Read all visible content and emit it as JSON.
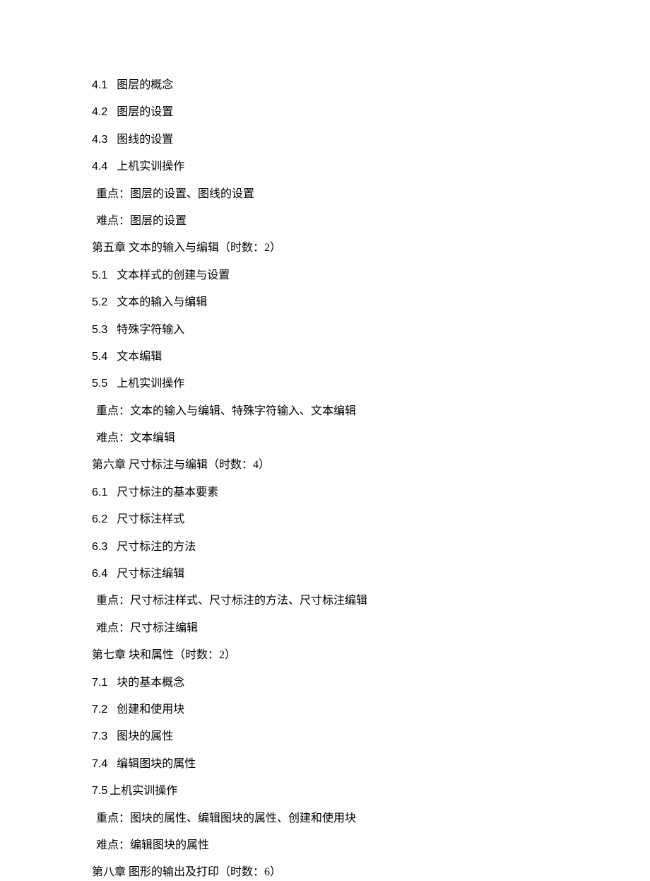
{
  "lines": [
    {
      "type": "sub",
      "num": "4.1",
      "text": "图层的概念"
    },
    {
      "type": "sub",
      "num": "4.2",
      "text": "图层的设置"
    },
    {
      "type": "sub",
      "num": "4.3",
      "text": "图线的设置"
    },
    {
      "type": "sub",
      "num": "4.4",
      "text": "上机实训操作"
    },
    {
      "type": "note",
      "text": "重点：图层的设置、图线的设置"
    },
    {
      "type": "note",
      "text": "难点：图层的设置"
    },
    {
      "type": "chapter",
      "text": "第五章  文本的输入与编辑（时数：2）"
    },
    {
      "type": "sub",
      "num": "5.1",
      "text": "文本样式的创建与设置"
    },
    {
      "type": "sub",
      "num": "5.2",
      "text": "文本的输入与编辑"
    },
    {
      "type": "sub",
      "num": "5.3",
      "text": "特殊字符输入"
    },
    {
      "type": "sub",
      "num": "5.4",
      "text": "文本编辑"
    },
    {
      "type": "sub",
      "num": "5.5",
      "text": "上机实训操作"
    },
    {
      "type": "note",
      "text": "重点：文本的输入与编辑、特殊字符输入、文本编辑"
    },
    {
      "type": "note",
      "text": "难点：文本编辑"
    },
    {
      "type": "chapter",
      "text": "第六章  尺寸标注与编辑（时数：4）"
    },
    {
      "type": "sub",
      "num": "6.1",
      "text": "尺寸标注的基本要素"
    },
    {
      "type": "sub",
      "num": "6.2",
      "text": "尺寸标注样式"
    },
    {
      "type": "sub",
      "num": "6.3",
      "text": "尺寸标注的方法"
    },
    {
      "type": "sub",
      "num": "6.4",
      "text": "尺寸标注编辑"
    },
    {
      "type": "note",
      "text": "重点：尺寸标注样式、尺寸标注的方法、尺寸标注编辑"
    },
    {
      "type": "note",
      "text": "难点：尺寸标注编辑"
    },
    {
      "type": "chapter",
      "text": "第七章  块和属性（时数：2）"
    },
    {
      "type": "sub",
      "num": "7.1",
      "text": "块的基本概念"
    },
    {
      "type": "sub",
      "num": "7.2",
      "text": "创建和使用块"
    },
    {
      "type": "sub",
      "num": "7.3",
      "text": "图块的属性"
    },
    {
      "type": "sub",
      "num": "7.4",
      "text": "编辑图块的属性"
    },
    {
      "type": "sub-tight",
      "num": "7.5",
      "text": "上机实训操作"
    },
    {
      "type": "note",
      "text": "重点：图块的属性、编辑图块的属性、创建和使用块"
    },
    {
      "type": "note",
      "text": "难点：编辑图块的属性"
    },
    {
      "type": "chapter",
      "text": "第八章 图形的输出及打印（时数：6）"
    }
  ]
}
